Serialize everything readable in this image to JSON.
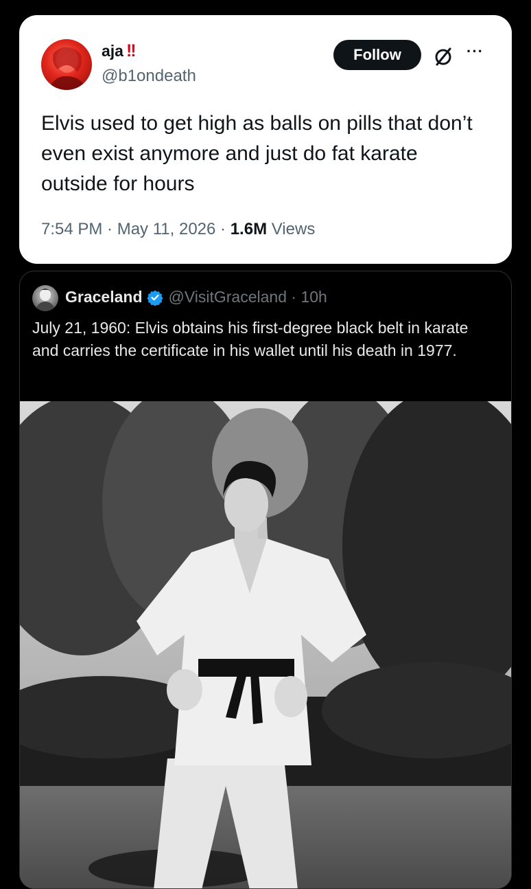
{
  "tweet": {
    "display_name": "aja",
    "name_emoji": "!!",
    "handle": "@b1ondeath",
    "follow_label": "Follow",
    "more_label": "···",
    "text": "Elvis used to get high as balls on pills that don’t even exist anymore and just do fat karate outside for hours",
    "time": "7:54 PM",
    "separator1": " · ",
    "date": "May 11, 2026",
    "separator2": " · ",
    "views_count": "1.6M",
    "views_label": " Views"
  },
  "quote": {
    "display_name": "Graceland",
    "handle_time": "@VisitGraceland · 10h",
    "text": "July 21, 1960: Elvis obtains his first-degree black belt in karate and carries the certificate in his wallet until his death in 1977.",
    "photo_icon": "photo"
  },
  "colors": {
    "background": "#000000",
    "card": "#ffffff",
    "follow_bg": "#0f1419",
    "verified": "#1d9bf0",
    "secondary_text": "#536471"
  }
}
